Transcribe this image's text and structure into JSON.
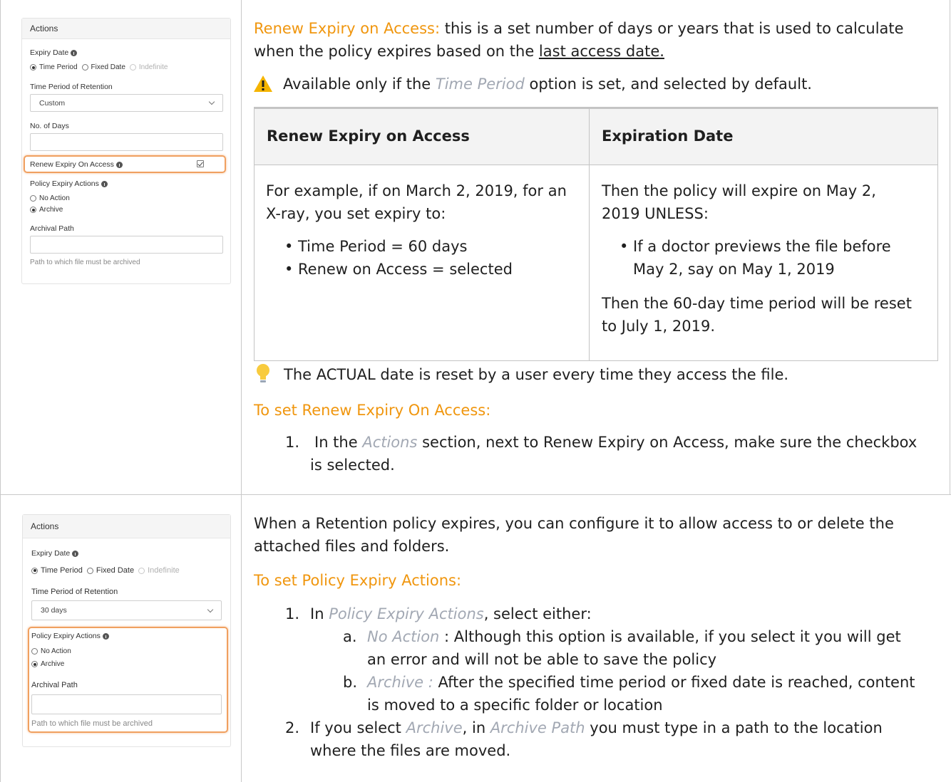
{
  "panel1": {
    "header": "Actions",
    "expiry_date_label": "Expiry Date",
    "radio_time_period": "Time Period",
    "radio_fixed_date": "Fixed Date",
    "radio_indefinite": "Indefinite",
    "retention_label": "Time Period of Retention",
    "retention_value": "Custom",
    "days_label": "No. of Days",
    "renew_label": "Renew Expiry On Access",
    "expiry_actions_label": "Policy Expiry Actions",
    "no_action": "No Action",
    "archive": "Archive",
    "archival_path_label": "Archival Path",
    "archival_hint": "Path to which file must be archived"
  },
  "panel2": {
    "header": "Actions",
    "expiry_date_label": "Expiry Date",
    "radio_time_period": "Time Period",
    "radio_fixed_date": "Fixed Date",
    "radio_indefinite": "Indefinite",
    "retention_label": "Time Period of Retention",
    "retention_value": "30 days",
    "expiry_actions_label": "Policy Expiry Actions",
    "no_action": "No Action",
    "archive": "Archive",
    "archival_path_label": "Archival Path",
    "archival_hint": "Path to which file must be archived"
  },
  "section1": {
    "renew_title": "Renew Expiry on Access:",
    "renew_text_a": " this is ",
    "renew_text_b": "a",
    "renew_text_c": " set number of days or years that is used to calculate",
    "renew_text_line2": "when the policy expires based on the ",
    "renew_link": "last access date. ",
    "warn_text_a": "Available only if the ",
    "warn_italic": "Time Period ",
    "warn_text_b": " option is set, and selected by default.",
    "table": {
      "head_left": "Renew Expiry on Access",
      "head_right": "Expiration Date",
      "left_line1": "For example, if on March 2, 2019, for an",
      "left_line2": "X-ray, you set expiry to:",
      "left_bullets": [
        "Time Period = 60 days",
        "Renew on Access = selected"
      ],
      "right_line1": "Then the policy will expire on May 2,",
      "right_line2": "2019 UNLESS:",
      "right_bullet_line1": "If a doctor previews the file before",
      "right_bullet_line2": "May 2, say on May 1, 2019",
      "right_after_line1": "Then the 60-day time period will be reset",
      "right_after_line2": "to July 1, 2019."
    },
    "tip_text": "The ACTUAL date is reset by a user every time they access the file.",
    "howto_title": "To set Renew Expiry On Access:",
    "step1_num": "1.",
    "step1_a": "In the ",
    "step1_italic": "Actions",
    "step1_b": " section, next to Renew Expiry on Access, make sure the checkbox",
    "step1_line2": "is selected."
  },
  "section2": {
    "intro_line1": "When a Retention policy expires, you can configure it to allow access to or delete the",
    "intro_line2": "attached files and folders.",
    "howto_title": "To set Policy Expiry Actions:",
    "step1_num": "1.",
    "step1_a": "In ",
    "step1_italic": "Policy Expiry Actions",
    "step1_b": ", select either:",
    "sub_a_num": "a.",
    "sub_a_italic": "No Action",
    "sub_a_text": " :  Although this option is available, if you select it you will get",
    "sub_a_line2": "an error and will not be able to save the policy",
    "sub_b_num": "b.",
    "sub_b_italic": "Archive :",
    "sub_b_text": "  After the specified time period or fixed date is reached, content",
    "sub_b_line2": "is moved to a specific folder or location",
    "step2_num": "2.",
    "step2_a": "If you select ",
    "step2_italic": "Archive",
    "step2_b": ", in ",
    "step2_italic2": "Archive Path",
    "step2_c": " you must type in a path to the location",
    "step2_line2": "where the files are moved."
  }
}
